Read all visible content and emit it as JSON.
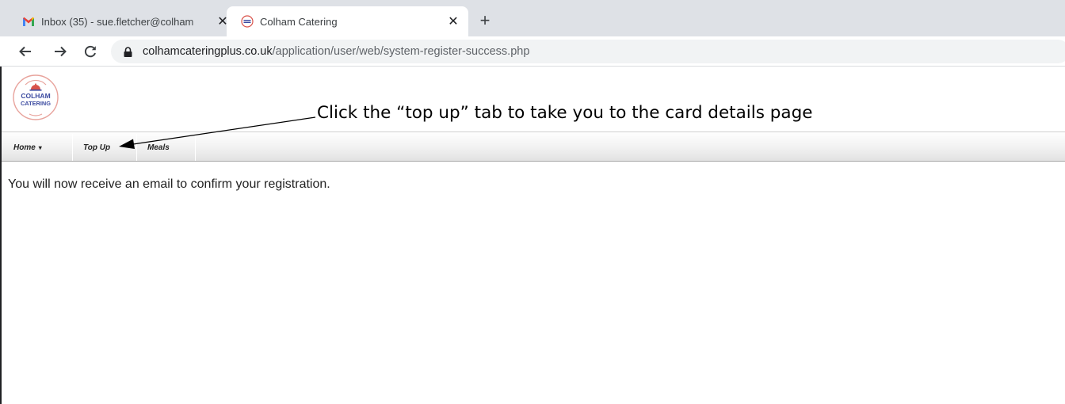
{
  "browser": {
    "tabs": [
      {
        "title": "Inbox (35) - sue.fletcher@colham",
        "icon": "gmail-icon",
        "active": false,
        "close": "✕"
      },
      {
        "title": "Colham Catering",
        "icon": "colham-favicon-icon",
        "active": true,
        "close": "✕"
      }
    ],
    "new_tab": "+",
    "url_domain": "colhamcateringplus.co.uk",
    "url_path": "/application/user/web/system-register-success.php"
  },
  "site": {
    "logo_line1": "COLHAM",
    "logo_line2": "CATERING",
    "nav": [
      {
        "label": "Home",
        "has_dropdown": true,
        "caret": "▾"
      },
      {
        "label": "Top Up",
        "has_dropdown": false
      },
      {
        "label": "Meals",
        "has_dropdown": false
      }
    ],
    "message": "You will now receive an email to confirm your registration.",
    "annotation": "Click the “top up” tab to take you to the card details page"
  },
  "colors": {
    "tabstrip": "#dee1e6",
    "omnibox": "#f1f3f4",
    "logo_blue": "#3b4aa0",
    "logo_red": "#d9524a"
  }
}
